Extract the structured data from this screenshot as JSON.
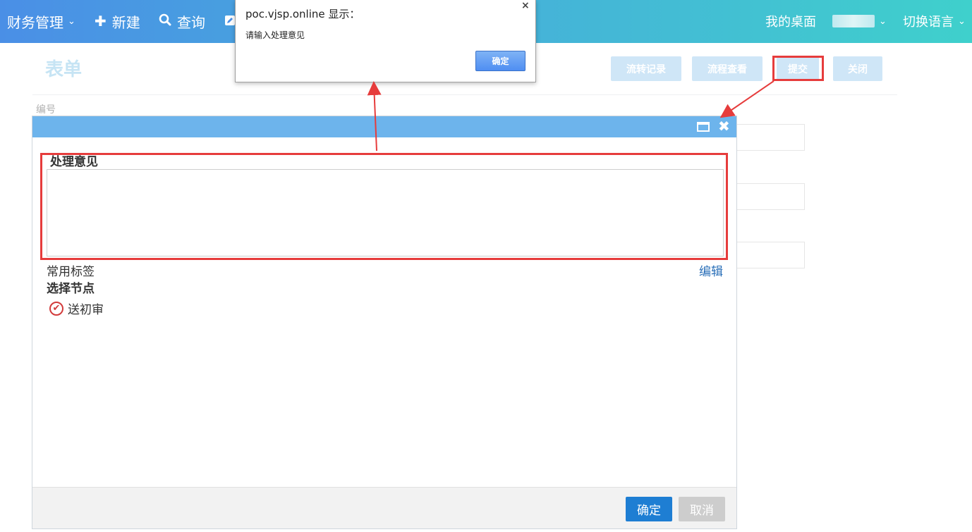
{
  "topbar": {
    "finance_menu": "财务管理",
    "new_label": "新建",
    "query_label": "查询",
    "desk_label": "我的桌面",
    "lang_label": "切换语言",
    "colors": {
      "gradient_start": "#4a8fe6",
      "gradient_end": "#3fd0cc"
    }
  },
  "page": {
    "title": "表单",
    "buttons": {
      "flow_record": "流转记录",
      "flow_view": "流程查看",
      "submit": "提交",
      "close": "关闭"
    },
    "field_label_number": "编号"
  },
  "modal": {
    "opinion_label": "处理意见",
    "opinion_value": "",
    "tags_label": "常用标签",
    "edit_link": "编辑",
    "node_label": "选择节点",
    "node_option": "送初审",
    "ok_button": "确定",
    "cancel_button": "取消",
    "icons": {
      "maximize": "maximize-icon",
      "close": "close-icon",
      "check": "check-circle-icon"
    }
  },
  "alert": {
    "title": "poc.vjsp.online 显示：",
    "message": "请输入处理意见",
    "ok_button": "确定",
    "close_glyph": "×"
  },
  "annotations": {
    "highlight_color": "#e63c3c"
  }
}
